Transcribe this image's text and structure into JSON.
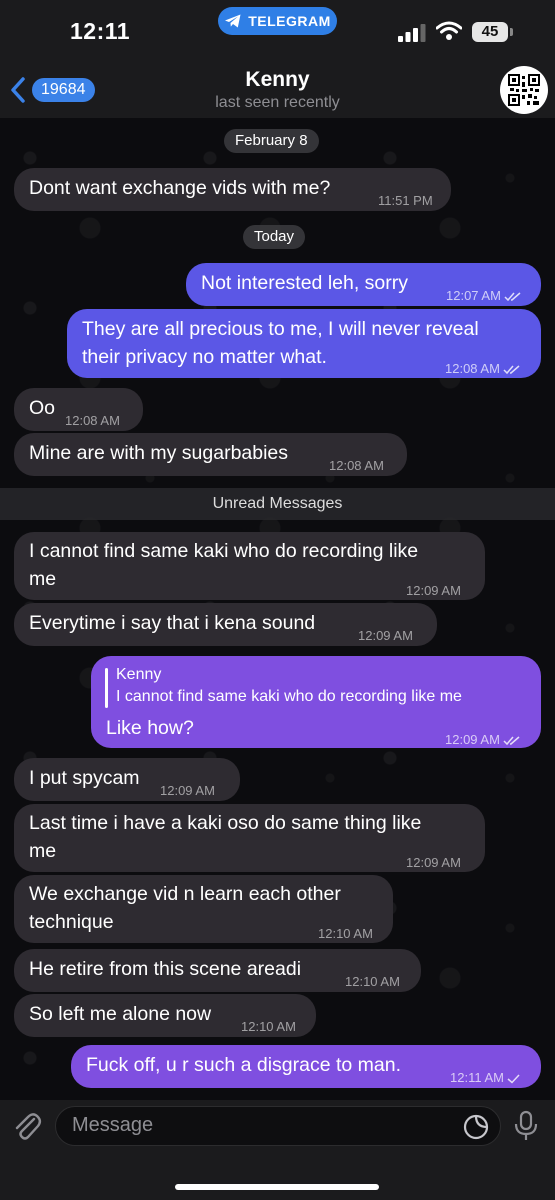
{
  "status_bar": {
    "time": "12:11",
    "telegram_label": "TELEGRAM",
    "battery": "45"
  },
  "header": {
    "back_count": "19684",
    "name": "Kenny",
    "status": "last seen recently"
  },
  "date_chips": {
    "first": "February 8",
    "second": "Today"
  },
  "unread_label": "Unread Messages",
  "messages": [
    {
      "dir": "in",
      "text": "Dont want exchange vids with me?",
      "time": "11:51 PM"
    },
    {
      "dir": "out",
      "text": "Not interested leh, sorry",
      "time": "12:07 AM"
    },
    {
      "dir": "out",
      "text_line1": "They are all precious to me, I will never reveal",
      "text_line2": "their privacy no matter what.",
      "time": "12:08 AM"
    },
    {
      "dir": "in",
      "text": "Oo",
      "time": "12:08 AM"
    },
    {
      "dir": "in",
      "text": "Mine are with my sugarbabies",
      "time": "12:08 AM"
    },
    {
      "dir": "in",
      "text_line1": "I cannot find same kaki who do recording like",
      "text_line2": "me",
      "time": "12:09 AM"
    },
    {
      "dir": "in",
      "text": "Everytime i say that i kena sound",
      "time": "12:09 AM"
    },
    {
      "dir": "out",
      "reply_name": "Kenny",
      "reply_text": "I cannot find same kaki who do recording like me",
      "text": "Like how?",
      "time": "12:09 AM"
    },
    {
      "dir": "in",
      "text": "I put spycam",
      "time": "12:09 AM"
    },
    {
      "dir": "in",
      "text_line1": "Last time i have a kaki oso do same thing like",
      "text_line2": "me",
      "time": "12:09 AM"
    },
    {
      "dir": "in",
      "text_line1": "We exchange vid n learn each other",
      "text_line2": "technique",
      "time": "12:10 AM"
    },
    {
      "dir": "in",
      "text": "He retire from this scene areadi",
      "time": "12:10 AM"
    },
    {
      "dir": "in",
      "text": "So left me alone now",
      "time": "12:10 AM"
    },
    {
      "dir": "out",
      "text": "Fuck off, u r such a disgrace to man.",
      "time": "12:11 AM"
    }
  ],
  "input": {
    "placeholder": "Message"
  },
  "colors": {
    "incoming": "#2e2b31",
    "outgoing_blue": "#5b57e6",
    "outgoing_purple": "#7f4fe0",
    "accent": "#3b82e8"
  }
}
